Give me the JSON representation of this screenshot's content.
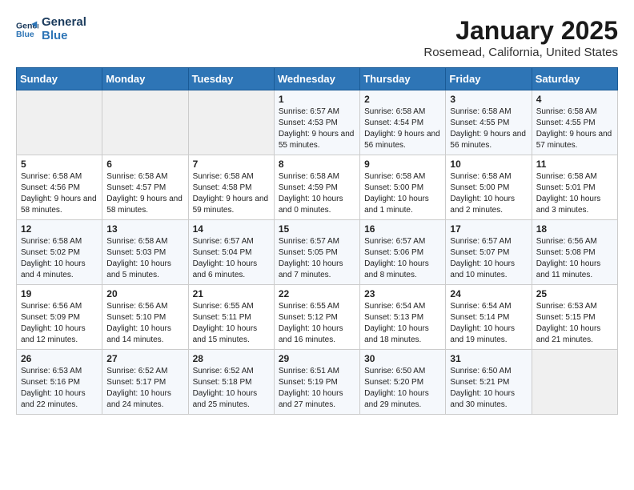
{
  "header": {
    "logo_line1": "General",
    "logo_line2": "Blue",
    "title": "January 2025",
    "subtitle": "Rosemead, California, United States"
  },
  "weekdays": [
    "Sunday",
    "Monday",
    "Tuesday",
    "Wednesday",
    "Thursday",
    "Friday",
    "Saturday"
  ],
  "weeks": [
    [
      {
        "day": "",
        "sunrise": "",
        "sunset": "",
        "daylight": ""
      },
      {
        "day": "",
        "sunrise": "",
        "sunset": "",
        "daylight": ""
      },
      {
        "day": "",
        "sunrise": "",
        "sunset": "",
        "daylight": ""
      },
      {
        "day": "1",
        "sunrise": "Sunrise: 6:57 AM",
        "sunset": "Sunset: 4:53 PM",
        "daylight": "Daylight: 9 hours and 55 minutes."
      },
      {
        "day": "2",
        "sunrise": "Sunrise: 6:58 AM",
        "sunset": "Sunset: 4:54 PM",
        "daylight": "Daylight: 9 hours and 56 minutes."
      },
      {
        "day": "3",
        "sunrise": "Sunrise: 6:58 AM",
        "sunset": "Sunset: 4:55 PM",
        "daylight": "Daylight: 9 hours and 56 minutes."
      },
      {
        "day": "4",
        "sunrise": "Sunrise: 6:58 AM",
        "sunset": "Sunset: 4:55 PM",
        "daylight": "Daylight: 9 hours and 57 minutes."
      }
    ],
    [
      {
        "day": "5",
        "sunrise": "Sunrise: 6:58 AM",
        "sunset": "Sunset: 4:56 PM",
        "daylight": "Daylight: 9 hours and 58 minutes."
      },
      {
        "day": "6",
        "sunrise": "Sunrise: 6:58 AM",
        "sunset": "Sunset: 4:57 PM",
        "daylight": "Daylight: 9 hours and 58 minutes."
      },
      {
        "day": "7",
        "sunrise": "Sunrise: 6:58 AM",
        "sunset": "Sunset: 4:58 PM",
        "daylight": "Daylight: 9 hours and 59 minutes."
      },
      {
        "day": "8",
        "sunrise": "Sunrise: 6:58 AM",
        "sunset": "Sunset: 4:59 PM",
        "daylight": "Daylight: 10 hours and 0 minutes."
      },
      {
        "day": "9",
        "sunrise": "Sunrise: 6:58 AM",
        "sunset": "Sunset: 5:00 PM",
        "daylight": "Daylight: 10 hours and 1 minute."
      },
      {
        "day": "10",
        "sunrise": "Sunrise: 6:58 AM",
        "sunset": "Sunset: 5:00 PM",
        "daylight": "Daylight: 10 hours and 2 minutes."
      },
      {
        "day": "11",
        "sunrise": "Sunrise: 6:58 AM",
        "sunset": "Sunset: 5:01 PM",
        "daylight": "Daylight: 10 hours and 3 minutes."
      }
    ],
    [
      {
        "day": "12",
        "sunrise": "Sunrise: 6:58 AM",
        "sunset": "Sunset: 5:02 PM",
        "daylight": "Daylight: 10 hours and 4 minutes."
      },
      {
        "day": "13",
        "sunrise": "Sunrise: 6:58 AM",
        "sunset": "Sunset: 5:03 PM",
        "daylight": "Daylight: 10 hours and 5 minutes."
      },
      {
        "day": "14",
        "sunrise": "Sunrise: 6:57 AM",
        "sunset": "Sunset: 5:04 PM",
        "daylight": "Daylight: 10 hours and 6 minutes."
      },
      {
        "day": "15",
        "sunrise": "Sunrise: 6:57 AM",
        "sunset": "Sunset: 5:05 PM",
        "daylight": "Daylight: 10 hours and 7 minutes."
      },
      {
        "day": "16",
        "sunrise": "Sunrise: 6:57 AM",
        "sunset": "Sunset: 5:06 PM",
        "daylight": "Daylight: 10 hours and 8 minutes."
      },
      {
        "day": "17",
        "sunrise": "Sunrise: 6:57 AM",
        "sunset": "Sunset: 5:07 PM",
        "daylight": "Daylight: 10 hours and 10 minutes."
      },
      {
        "day": "18",
        "sunrise": "Sunrise: 6:56 AM",
        "sunset": "Sunset: 5:08 PM",
        "daylight": "Daylight: 10 hours and 11 minutes."
      }
    ],
    [
      {
        "day": "19",
        "sunrise": "Sunrise: 6:56 AM",
        "sunset": "Sunset: 5:09 PM",
        "daylight": "Daylight: 10 hours and 12 minutes."
      },
      {
        "day": "20",
        "sunrise": "Sunrise: 6:56 AM",
        "sunset": "Sunset: 5:10 PM",
        "daylight": "Daylight: 10 hours and 14 minutes."
      },
      {
        "day": "21",
        "sunrise": "Sunrise: 6:55 AM",
        "sunset": "Sunset: 5:11 PM",
        "daylight": "Daylight: 10 hours and 15 minutes."
      },
      {
        "day": "22",
        "sunrise": "Sunrise: 6:55 AM",
        "sunset": "Sunset: 5:12 PM",
        "daylight": "Daylight: 10 hours and 16 minutes."
      },
      {
        "day": "23",
        "sunrise": "Sunrise: 6:54 AM",
        "sunset": "Sunset: 5:13 PM",
        "daylight": "Daylight: 10 hours and 18 minutes."
      },
      {
        "day": "24",
        "sunrise": "Sunrise: 6:54 AM",
        "sunset": "Sunset: 5:14 PM",
        "daylight": "Daylight: 10 hours and 19 minutes."
      },
      {
        "day": "25",
        "sunrise": "Sunrise: 6:53 AM",
        "sunset": "Sunset: 5:15 PM",
        "daylight": "Daylight: 10 hours and 21 minutes."
      }
    ],
    [
      {
        "day": "26",
        "sunrise": "Sunrise: 6:53 AM",
        "sunset": "Sunset: 5:16 PM",
        "daylight": "Daylight: 10 hours and 22 minutes."
      },
      {
        "day": "27",
        "sunrise": "Sunrise: 6:52 AM",
        "sunset": "Sunset: 5:17 PM",
        "daylight": "Daylight: 10 hours and 24 minutes."
      },
      {
        "day": "28",
        "sunrise": "Sunrise: 6:52 AM",
        "sunset": "Sunset: 5:18 PM",
        "daylight": "Daylight: 10 hours and 25 minutes."
      },
      {
        "day": "29",
        "sunrise": "Sunrise: 6:51 AM",
        "sunset": "Sunset: 5:19 PM",
        "daylight": "Daylight: 10 hours and 27 minutes."
      },
      {
        "day": "30",
        "sunrise": "Sunrise: 6:50 AM",
        "sunset": "Sunset: 5:20 PM",
        "daylight": "Daylight: 10 hours and 29 minutes."
      },
      {
        "day": "31",
        "sunrise": "Sunrise: 6:50 AM",
        "sunset": "Sunset: 5:21 PM",
        "daylight": "Daylight: 10 hours and 30 minutes."
      },
      {
        "day": "",
        "sunrise": "",
        "sunset": "",
        "daylight": ""
      }
    ]
  ]
}
